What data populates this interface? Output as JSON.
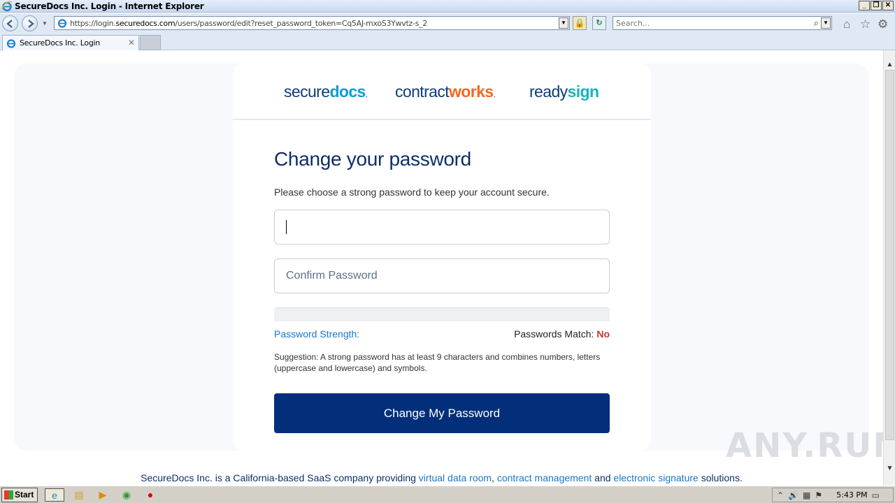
{
  "window": {
    "title": "SecureDocs Inc. Login - Internet Explorer",
    "minimize": "_",
    "restore": "❐",
    "close": "✕"
  },
  "browser": {
    "url_prefix": "https://login.",
    "url_domain": "securedocs.com",
    "url_path": "/users/password/edit?reset_password_token=Cq5AJ-mxoS3Ywvtz-s_2",
    "search_placeholder": "Search...",
    "tab_label": "SecureDocs Inc. Login"
  },
  "logos": {
    "securedocs_a": "secure",
    "securedocs_b": "docs",
    "contractworks_a": "contract",
    "contractworks_b": "works",
    "readysign_a": "ready",
    "readysign_b": "sign",
    "dot": "."
  },
  "form": {
    "heading": "Change your password",
    "subtitle": "Please choose a strong password to keep your account secure.",
    "password_value": "",
    "confirm_placeholder": "Confirm Password",
    "strength_label": "Password Strength:",
    "strength_fraction": 0,
    "match_label": "Passwords Match:",
    "match_value": "No",
    "suggestion": "Suggestion: A strong password has at least 9 characters and combines numbers, letters (uppercase and lowercase) and symbols.",
    "submit_label": "Change My Password"
  },
  "footer": {
    "text_1": "SecureDocs Inc. is a California-based SaaS company providing ",
    "link_1": "virtual data room",
    "sep_1": ", ",
    "link_2": "contract management",
    "sep_2": " and ",
    "link_3": "electronic signature",
    "text_2": " solutions."
  },
  "watermark": "ANY.RUN",
  "taskbar": {
    "start_label": "Start",
    "clock": "5:43 PM"
  },
  "colors": {
    "brand_navy": "#032f7a",
    "heading_navy": "#0d2f66",
    "link_blue": "#1a76c8",
    "error_red": "#c0392b",
    "securedocs_blue": "#0b9dd8",
    "contractworks_orange": "#f26a21",
    "readysign_teal": "#17b3bf"
  }
}
